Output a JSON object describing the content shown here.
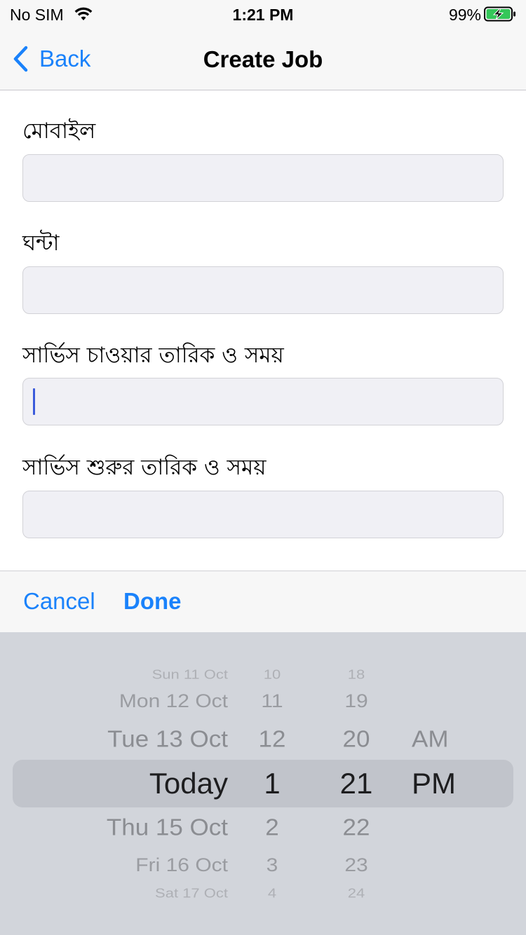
{
  "status_bar": {
    "carrier": "No SIM",
    "time": "1:21 PM",
    "battery_percent": "99%",
    "wifi_icon": "wifi-icon",
    "battery_icon": "battery-charging-icon"
  },
  "nav": {
    "back_label": "Back",
    "title": "Create Job"
  },
  "form": {
    "fields": [
      {
        "label": "মোবাইল",
        "value": "",
        "placeholder": ""
      },
      {
        "label": "ঘন্টা",
        "value": "",
        "placeholder": ""
      },
      {
        "label": "সার্ভিস চাওয়ার তারিক ও সময়",
        "value": "",
        "placeholder": ""
      },
      {
        "label": "সার্ভিস শুরুর তারিক ও সময়",
        "value": "",
        "placeholder": ""
      }
    ]
  },
  "toolbar": {
    "cancel_label": "Cancel",
    "done_label": "Done"
  },
  "picker": {
    "dates": [
      "Sun 11 Oct",
      "Mon 12 Oct",
      "Tue 13 Oct",
      "Today",
      "Thu 15 Oct",
      "Fri 16 Oct",
      "Sat 17 Oct"
    ],
    "hours": [
      "10",
      "11",
      "12",
      "1",
      "2",
      "3",
      "4"
    ],
    "minutes": [
      "18",
      "19",
      "20",
      "21",
      "22",
      "23",
      "24"
    ],
    "periods": [
      "AM",
      "PM"
    ],
    "selected": {
      "date": "Today",
      "hour": "1",
      "minute": "21",
      "period": "PM"
    }
  },
  "colors": {
    "accent": "#1a82fb",
    "cursor": "#3b5bdb",
    "input_bg": "#f0f0f5",
    "picker_bg": "#d2d5db"
  }
}
